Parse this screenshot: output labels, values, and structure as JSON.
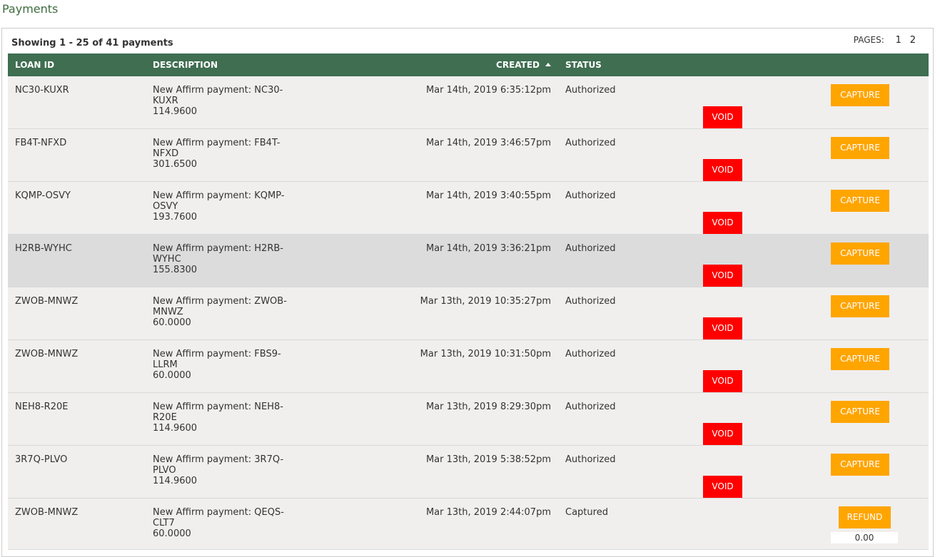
{
  "page": {
    "title": "Payments"
  },
  "summary": "Showing 1 - 25 of 41 payments",
  "pagination": {
    "label": "PAGES:",
    "pages": [
      "1",
      "2"
    ]
  },
  "table": {
    "headers": {
      "loan_id": "LOAN ID",
      "description": "DESCRIPTION",
      "created": "CREATED",
      "status": "STATUS"
    },
    "sort": {
      "column": "created",
      "direction": "ascending"
    },
    "rows": [
      {
        "loan_id": "NC30-KUXR",
        "desc_line1": "New Affirm payment: NC30-KUXR",
        "desc_line2": "114.9600",
        "created": "Mar 14th, 2019 6:35:12pm",
        "status": "Authorized",
        "actions": [
          "CAPTURE",
          "VOID"
        ]
      },
      {
        "loan_id": "FB4T-NFXD",
        "desc_line1": "New Affirm payment: FB4T-NFXD",
        "desc_line2": "301.6500",
        "created": "Mar 14th, 2019 3:46:57pm",
        "status": "Authorized",
        "actions": [
          "CAPTURE",
          "VOID"
        ]
      },
      {
        "loan_id": "KQMP-OSVY",
        "desc_line1": "New Affirm payment: KQMP-OSVY",
        "desc_line2": "193.7600",
        "created": "Mar 14th, 2019 3:40:55pm",
        "status": "Authorized",
        "actions": [
          "CAPTURE",
          "VOID"
        ]
      },
      {
        "loan_id": "H2RB-WYHC",
        "desc_line1": "New Affirm payment: H2RB-WYHC",
        "desc_line2": "155.8300",
        "created": "Mar 14th, 2019 3:36:21pm",
        "status": "Authorized",
        "actions": [
          "CAPTURE",
          "VOID"
        ]
      },
      {
        "loan_id": "ZWOB-MNWZ",
        "desc_line1": "New Affirm payment: ZWOB-MNWZ",
        "desc_line2": "60.0000",
        "created": "Mar 13th, 2019 10:35:27pm",
        "status": "Authorized",
        "actions": [
          "CAPTURE",
          "VOID"
        ]
      },
      {
        "loan_id": "ZWOB-MNWZ",
        "desc_line1": "New Affirm payment: FBS9-LLRM",
        "desc_line2": "60.0000",
        "created": "Mar 13th, 2019 10:31:50pm",
        "status": "Authorized",
        "actions": [
          "CAPTURE",
          "VOID"
        ]
      },
      {
        "loan_id": "NEH8-R20E",
        "desc_line1": "New Affirm payment: NEH8-R20E",
        "desc_line2": "114.9600",
        "created": "Mar 13th, 2019 8:29:30pm",
        "status": "Authorized",
        "actions": [
          "CAPTURE",
          "VOID"
        ]
      },
      {
        "loan_id": "3R7Q-PLVO",
        "desc_line1": "New Affirm payment: 3R7Q-PLVO",
        "desc_line2": "114.9600",
        "created": "Mar 13th, 2019 5:38:52pm",
        "status": "Authorized",
        "actions": [
          "CAPTURE",
          "VOID"
        ]
      },
      {
        "loan_id": "ZWOB-MNWZ",
        "desc_line1": "New Affirm payment: QEQS-CLT7",
        "desc_line2": "60.0000",
        "created": "Mar 13th, 2019 2:44:07pm",
        "status": "Captured",
        "actions": [
          "REFUND"
        ],
        "refund_amount": "0.00"
      }
    ]
  },
  "colors": {
    "header_bg": "#3f6e51",
    "title": "#3d6b3d",
    "capture_button": "#ffa500",
    "void_button": "#ff0000",
    "row_bg": "#f0efee",
    "row_hover_bg": "#dcdcdc"
  },
  "icons": {
    "sort": "sort-ascending-icon"
  }
}
